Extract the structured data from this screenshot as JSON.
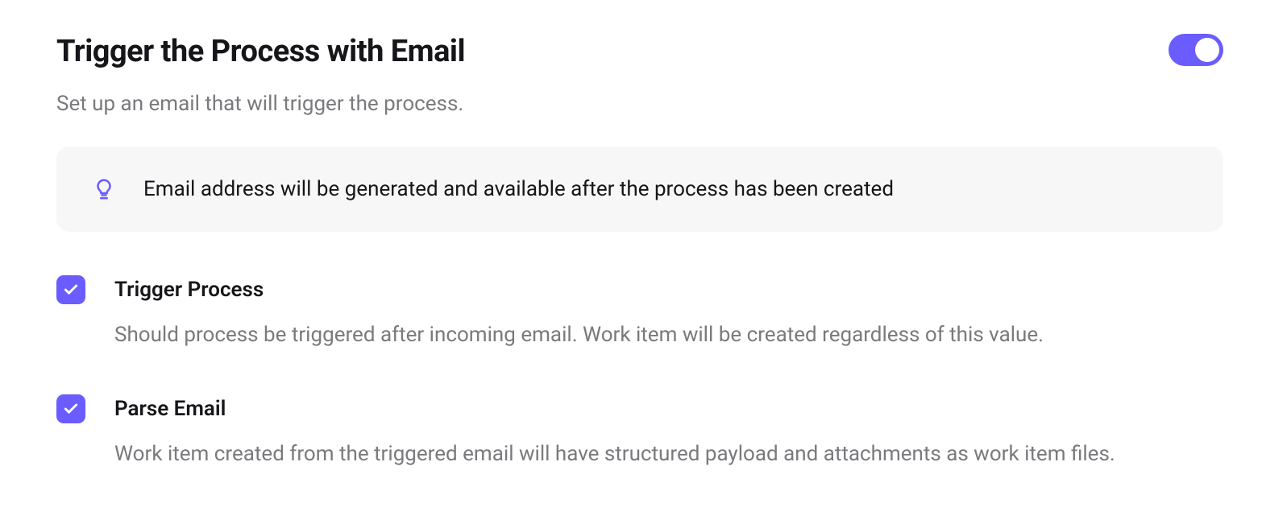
{
  "header": {
    "title": "Trigger the Process with Email",
    "subtitle": "Set up an email that will trigger the process.",
    "toggle_on": true
  },
  "info": {
    "text": "Email address will be generated and available after the process has been created"
  },
  "options": [
    {
      "key": "trigger-process",
      "label": "Trigger Process",
      "description": "Should process be triggered after incoming email. Work item will be created regardless of this value.",
      "checked": true
    },
    {
      "key": "parse-email",
      "label": "Parse Email",
      "description": "Work item created from the triggered email will have structured payload and attachments as work item files.",
      "checked": true
    }
  ]
}
